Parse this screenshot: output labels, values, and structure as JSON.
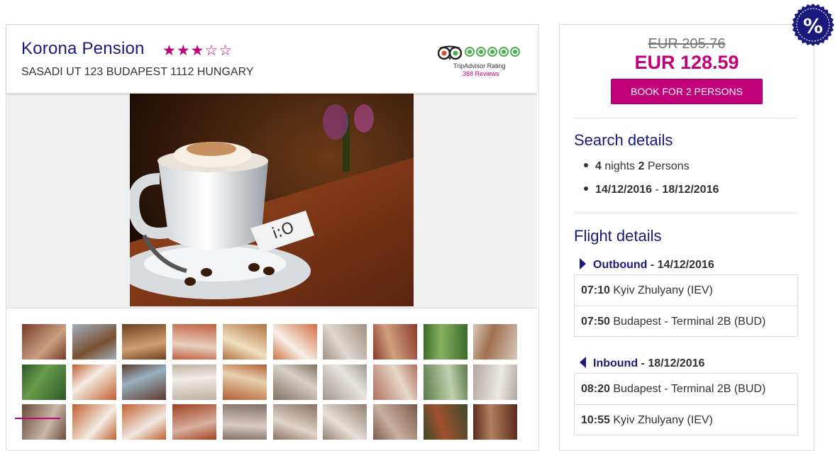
{
  "hotel": {
    "name": "Korona Pension",
    "stars_filled": 3,
    "stars_total": 5,
    "stars_filled_text": "★★★",
    "stars_empty_text": "☆☆",
    "address": "SASADI UT 123 BUDAPEST 1112 HUNGARY",
    "tripadvisor": {
      "label": "TripAdvisor Rating",
      "reviews": "368 Reviews",
      "rating": 5
    }
  },
  "gallery": {
    "thumbnail_count": 30,
    "selected_index": 0
  },
  "booking": {
    "old_price": "EUR 205.76",
    "new_price": "EUR 128.59",
    "book_button": "BOOK FOR 2 PERSONS",
    "discount_icon": "%"
  },
  "search_details": {
    "title": "Search details",
    "nights": "4",
    "nights_label": "nights",
    "persons": "2",
    "persons_label": "Persons",
    "date_from": "14/12/2016",
    "date_separator": " - ",
    "date_to": "18/12/2016"
  },
  "flight_details": {
    "title": "Flight details",
    "outbound": {
      "label": "Outbound",
      "date": " - 14/12/2016",
      "rows": [
        {
          "time": "07:10",
          "place": "Kyiv Zhulyany (IEV)"
        },
        {
          "time": "07:50",
          "place": "Budapest - Terminal 2B (BUD)"
        }
      ]
    },
    "inbound": {
      "label": "Inbound",
      "date": " - 18/12/2016",
      "rows": [
        {
          "time": "08:20",
          "place": "Budapest - Terminal 2B (BUD)"
        },
        {
          "time": "10:55",
          "place": "Kyiv Zhulyany (IEV)"
        }
      ]
    }
  },
  "colors": {
    "accent": "#c2007a",
    "navy": "#1a1a7e",
    "tripadvisor_green": "#4caf50"
  }
}
